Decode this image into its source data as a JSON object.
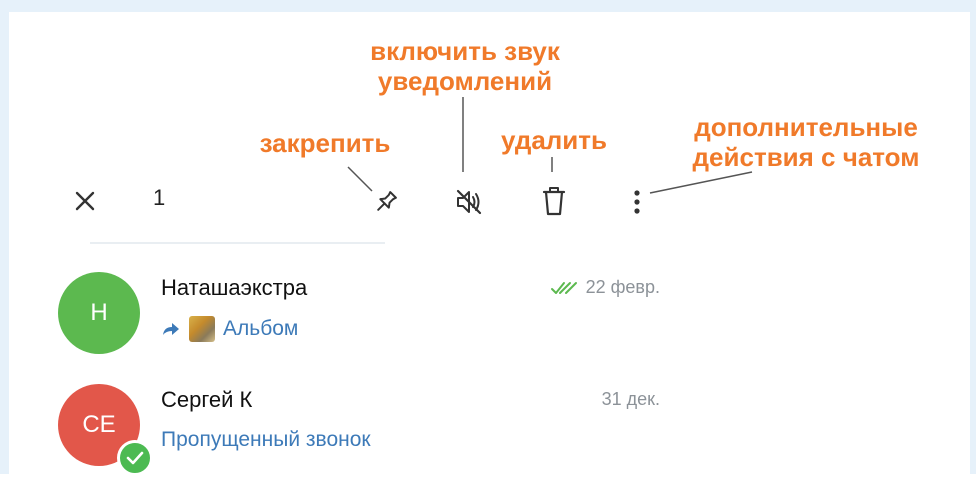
{
  "annotations": {
    "pin": "закрепить",
    "unmute_line1": "включить звук",
    "unmute_line2": "уведомлений",
    "delete": "удалить",
    "more_line1": "дополнительные",
    "more_line2": "действия с чатом"
  },
  "toolbar": {
    "selected_count": "1",
    "icons": [
      "close-icon",
      "pin-icon",
      "unmute-icon",
      "trash-icon",
      "more-vertical-icon"
    ]
  },
  "chats": [
    {
      "avatar_initials": "Н",
      "avatar_color": "#5cb94f",
      "name": "Наташаэкстра",
      "time": "22 февр.",
      "read_status": "double-check",
      "preview_icon": "forward-icon",
      "preview": "Альбом"
    },
    {
      "avatar_initials": "СЕ",
      "avatar_color": "#e2574a",
      "name": "Сергей К",
      "time": "31 дек.",
      "preview": "Пропущенный звонок",
      "badge": "check-badge-icon"
    }
  ],
  "colors": {
    "annotation": "#f07a2a",
    "link_blue": "#3d7ab8",
    "read_check": "#5cb94f",
    "frame": "#e6f1fa"
  }
}
